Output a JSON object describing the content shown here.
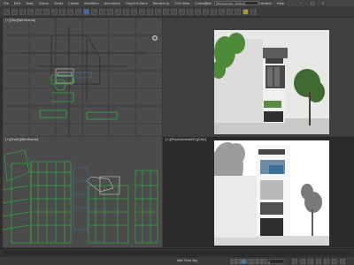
{
  "menubar": {
    "items": [
      "File",
      "Edit",
      "Tools",
      "Group",
      "Views",
      "Create",
      "Modifiers",
      "Animation",
      "Graph Editors",
      "Rendering",
      "Civil View",
      "Customize",
      "Scripting",
      "Interactive",
      "Content",
      "Help"
    ],
    "workspace": "Workspaces: Default"
  },
  "viewports": {
    "top_left": {
      "label": "[+][Top][Wireframe]"
    },
    "top_right": {
      "label": ""
    },
    "bottom_left": {
      "label": "[+][Front][Wireframe]"
    },
    "bottom_right": {
      "label": "[+][PhysCamera001][Clay]"
    }
  },
  "status": {
    "frame": "0",
    "add_time_tag": "Add Time Tag"
  },
  "colors": {
    "wire_green": "#22d13a",
    "wire_white": "#e6e6e6",
    "accent_blue": "#3c7fc4"
  }
}
